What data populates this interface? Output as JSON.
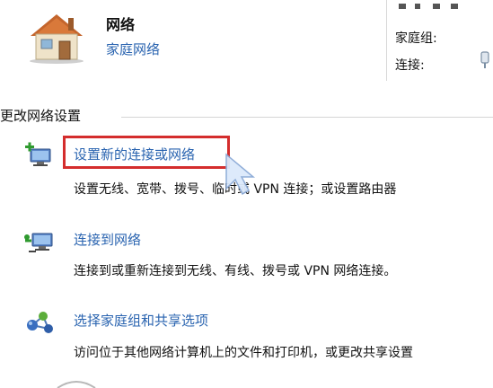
{
  "network": {
    "name": "网络",
    "type": "家庭网络",
    "homegroup_label": "家庭组:",
    "connect_label": "连接:"
  },
  "section": {
    "title": "更改网络设置"
  },
  "tasks": [
    {
      "icon": "new-connection-icon",
      "link": "设置新的连接或网络",
      "desc": "设置无线、宽带、拨号、临时或 VPN 连接；或设置路由器"
    },
    {
      "icon": "connect-to-network-icon",
      "link": "连接到网络",
      "desc": "连接到或重新连接到无线、有线、拨号或 VPN 网络连接。"
    },
    {
      "icon": "homegroup-sharing-icon",
      "link": "选择家庭组和共享选项",
      "desc": "访问位于其他网络计算机上的文件和打印机，或更改共享设置"
    }
  ],
  "colors": {
    "link": "#2a64b0",
    "highlight": "#d42d2d"
  }
}
